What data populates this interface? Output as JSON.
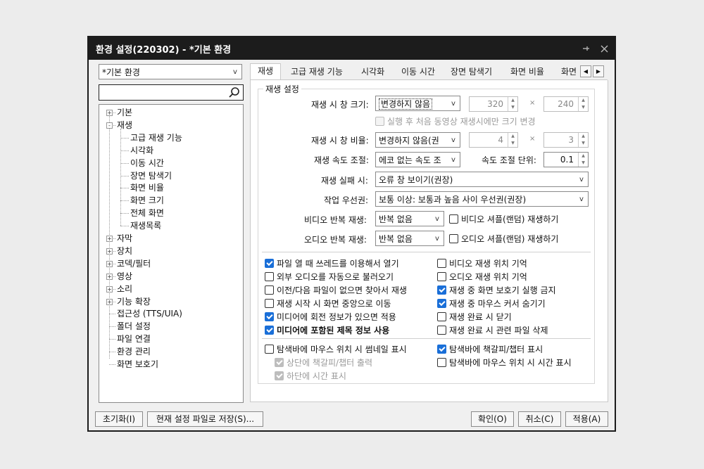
{
  "window": {
    "title": "환경 설정(220302) - *기본 환경"
  },
  "profile": {
    "value": "*기본 환경"
  },
  "search": {
    "value": ""
  },
  "tree": {
    "items": [
      "기본",
      "재생",
      "고급 재생 기능",
      "시각화",
      "이동 시간",
      "장면 탐색기",
      "화면 비율",
      "화면 크기",
      "전체 화면",
      "재생목록",
      "자막",
      "장치",
      "코덱/필터",
      "영상",
      "소리",
      "기능 확장",
      "접근성 (TTS/UIA)",
      "폴더 설정",
      "파일 연결",
      "환경 관리",
      "화면 보호기"
    ]
  },
  "tabs": [
    "재생",
    "고급 재생 기능",
    "시각화",
    "이동 시간",
    "장면 탐색기",
    "화면 비율",
    "화면"
  ],
  "playback": {
    "group_title": "재생 설정",
    "window_size_label": "재생 시 창 크기:",
    "window_size_value": "변경하지 않음",
    "width": "320",
    "height": "240",
    "times": "×",
    "first_video_only": "실행 후 처음 동영상 재생시에만 크기 변경",
    "ratio_label": "재생 시 창 비율:",
    "ratio_value": "변경하지 않음(권",
    "ratio_w": "4",
    "ratio_h": "3",
    "speed_label": "재생 속도 조절:",
    "speed_value": "에코 없는 속도 조",
    "speed_unit_label": "속도 조절 단위:",
    "speed_unit_value": "0.1",
    "fail_label": "재생 실패 시:",
    "fail_value": "오류 창 보이기(권장)",
    "priority_label": "작업 우선권:",
    "priority_value": "보통 이상: 보통과 높음 사이 우선권(권장)",
    "video_repeat_label": "비디오 반복 재생:",
    "video_repeat_value": "반복 없음",
    "video_shuffle": "비디오 셔플(랜덤) 재생하기",
    "audio_repeat_label": "오디오 반복 재생:",
    "audio_repeat_value": "반복 없음",
    "audio_shuffle": "오디오 셔플(랜덤) 재생하기"
  },
  "options": {
    "left": [
      {
        "label": "파일 열 때 쓰레드를 이용해서 열기",
        "checked": true
      },
      {
        "label": "외부 오디오를 자동으로 불러오기",
        "checked": false
      },
      {
        "label": "이전/다음 파일이 없으면 찾아서 재생",
        "checked": false
      },
      {
        "label": "재생 시작 시 화면 중앙으로 이동",
        "checked": false
      },
      {
        "label": "미디어에 회전 정보가 있으면 적용",
        "checked": true
      },
      {
        "label": "미디어에 포함된 제목 정보 사용",
        "checked": true
      }
    ],
    "right": [
      {
        "label": "비디오 재생 위치 기억",
        "checked": false
      },
      {
        "label": "오디오 재생 위치 기억",
        "checked": false
      },
      {
        "label": "재생 중 화면 보호기 실행 금지",
        "checked": true
      },
      {
        "label": "재생 중 마우스 커서 숨기기",
        "checked": true
      },
      {
        "label": "재생 완료 시 닫기",
        "checked": false
      },
      {
        "label": "재생 완료 시 관련 파일 삭제",
        "checked": false
      }
    ]
  },
  "seekbar": {
    "thumbnail": "탐색바에 마우스 위치 시 썸네일 표시",
    "chapter_top": "상단에 책갈피/챕터 출력",
    "time_bottom": "하단에 시간 표시",
    "chapter_show": "탐색바에 책갈피/챕터 표시",
    "time_hover": "탐색바에 마우스 위치 시 시간 표시"
  },
  "buttons": {
    "reset": "초기화(I)",
    "save_file": "현재 설정 파일로 저장(S)...",
    "ok": "확인(O)",
    "cancel": "취소(C)",
    "apply": "적용(A)"
  },
  "icons": {
    "pin": "pin-icon",
    "close": "close-icon",
    "search": "search-icon"
  },
  "colors": {
    "titlebar": "#1c1c1c",
    "checkbox_accent": "#1a6fd8"
  }
}
